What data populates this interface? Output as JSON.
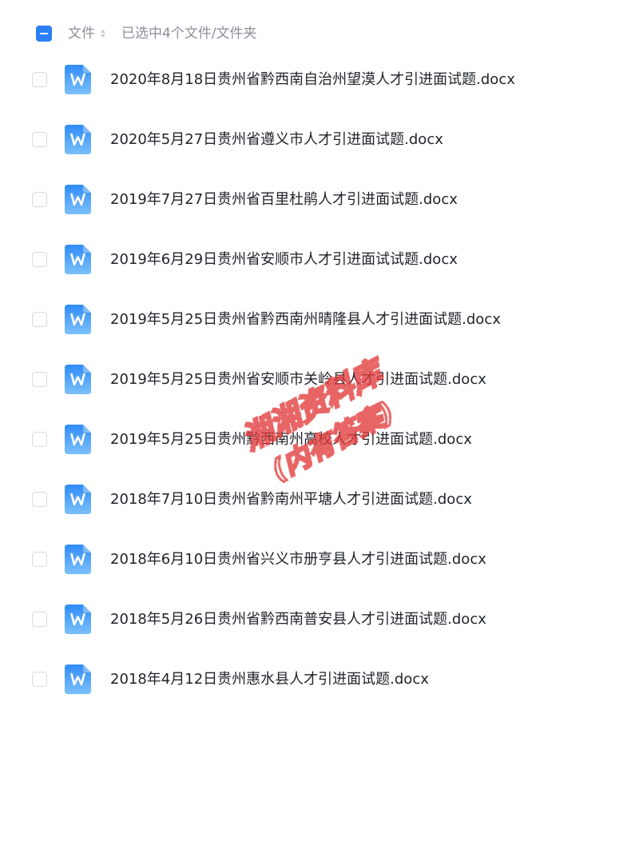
{
  "header": {
    "column_label": "文件",
    "selection_status": "已选中4个文件/文件夹"
  },
  "files": [
    {
      "name": "2020年8月18日贵州省黔西南自治州望漠人才引进面试题.docx",
      "icon": "word-doc-icon",
      "checked": false
    },
    {
      "name": "2020年5月27日贵州省遵义市人才引进面试题.docx",
      "icon": "word-doc-icon",
      "checked": false
    },
    {
      "name": "2019年7月27日贵州省百里杜鹃人才引进面试题.docx",
      "icon": "word-doc-icon",
      "checked": false
    },
    {
      "name": "2019年6月29日贵州省安顺市人才引进面试试题.docx",
      "icon": "word-doc-icon",
      "checked": false
    },
    {
      "name": "2019年5月25日贵州省黔西南州晴隆县人才引进面试题.docx",
      "icon": "word-doc-icon",
      "checked": false
    },
    {
      "name": "2019年5月25日贵州省安顺市关岭县人才引进面试题.docx",
      "icon": "word-doc-icon",
      "checked": false
    },
    {
      "name": "2019年5月25日贵州黔西南州高校人才引进面试题.docx",
      "icon": "word-doc-icon",
      "checked": false
    },
    {
      "name": "2018年7月10日贵州省黔南州平塘人才引进面试题.docx",
      "icon": "word-doc-icon",
      "checked": false
    },
    {
      "name": "2018年6月10日贵州省兴义市册亨县人才引进面试题.docx",
      "icon": "word-doc-icon",
      "checked": false
    },
    {
      "name": "2018年5月26日贵州省黔西南普安县人才引进面试题.docx",
      "icon": "word-doc-icon",
      "checked": false
    },
    {
      "name": "2018年4月12日贵州惠水县人才引进面试题.docx",
      "icon": "word-doc-icon",
      "checked": false
    }
  ],
  "watermark": {
    "line1": "湘湘资料库",
    "line2": "(内有答案)"
  },
  "colors": {
    "accent": "#2b7ff5",
    "icon_top": "#2f8cf7",
    "icon_bottom": "#7cc0fb",
    "watermark": "#e23a3a",
    "muted_text": "#8a8f99"
  }
}
